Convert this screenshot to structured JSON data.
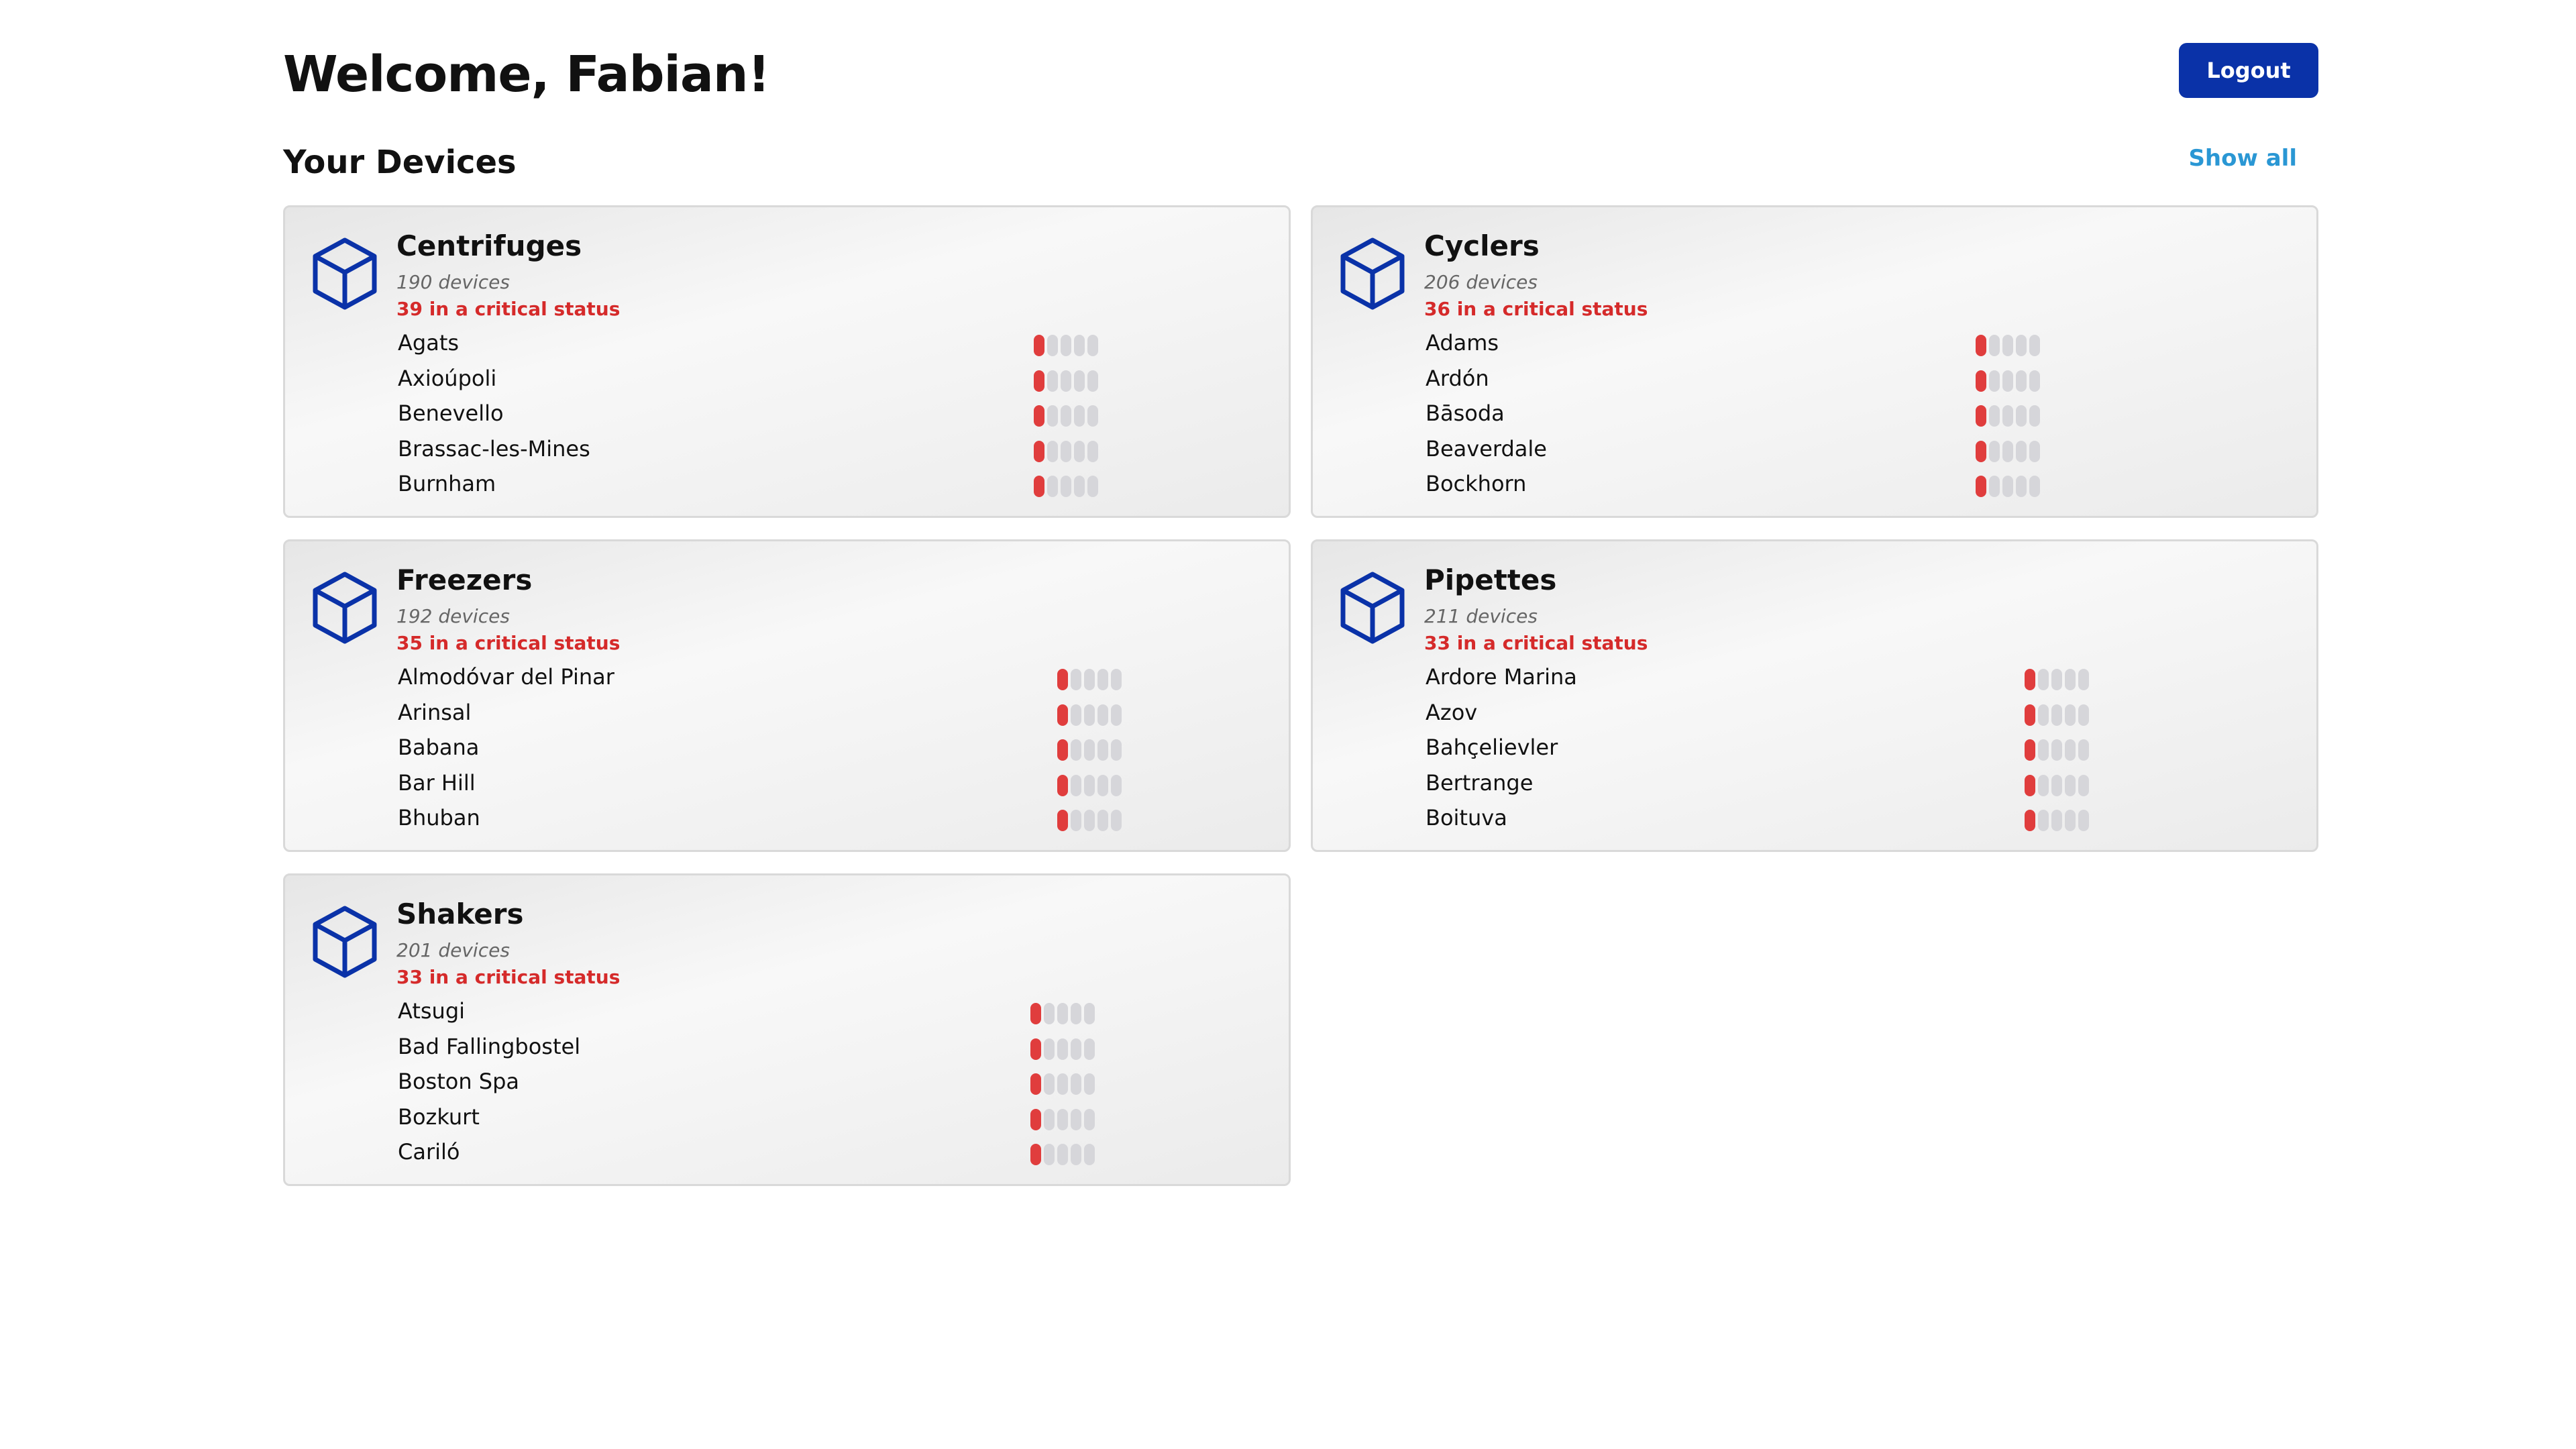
{
  "header": {
    "welcome": "Welcome, Fabian!",
    "logout_label": "Logout"
  },
  "section": {
    "title": "Your Devices",
    "show_all_label": "Show all"
  },
  "colors": {
    "primary": "#0a32a8",
    "link": "#2a97d4",
    "critical": "#d52a2a",
    "meter_active": "#e03d3d",
    "meter_inactive": "#d6d6da"
  },
  "meter": {
    "segments": 5,
    "level": 1
  },
  "cards": [
    {
      "title": "Centrifuges",
      "icon": "cube-icon",
      "count": "190 devices",
      "critical": "39 in a critical status",
      "devices": [
        "Agats",
        "Axioúpoli",
        "Benevello",
        "Brassac-les-Mines",
        "Burnham"
      ]
    },
    {
      "title": "Cyclers",
      "icon": "cube-icon",
      "count": "206 devices",
      "critical": "36 in a critical status",
      "devices": [
        "Adams",
        "Ardón",
        "Bāsoda",
        "Beaverdale",
        "Bockhorn"
      ]
    },
    {
      "title": "Freezers",
      "icon": "cube-icon",
      "count": "192 devices",
      "critical": "35 in a critical status",
      "devices": [
        "Almodóvar del Pinar",
        "Arinsal",
        "Babana",
        "Bar Hill",
        "Bhuban"
      ]
    },
    {
      "title": "Pipettes",
      "icon": "cube-icon",
      "count": "211 devices",
      "critical": "33 in a critical status",
      "devices": [
        "Ardore Marina",
        "Azov",
        "Bahçelievler",
        "Bertrange",
        "Boituva"
      ]
    },
    {
      "title": "Shakers",
      "icon": "cube-icon",
      "count": "201 devices",
      "critical": "33 in a critical status",
      "devices": [
        "Atsugi",
        "Bad Fallingbostel",
        "Boston Spa",
        "Bozkurt",
        "Cariló"
      ]
    }
  ]
}
